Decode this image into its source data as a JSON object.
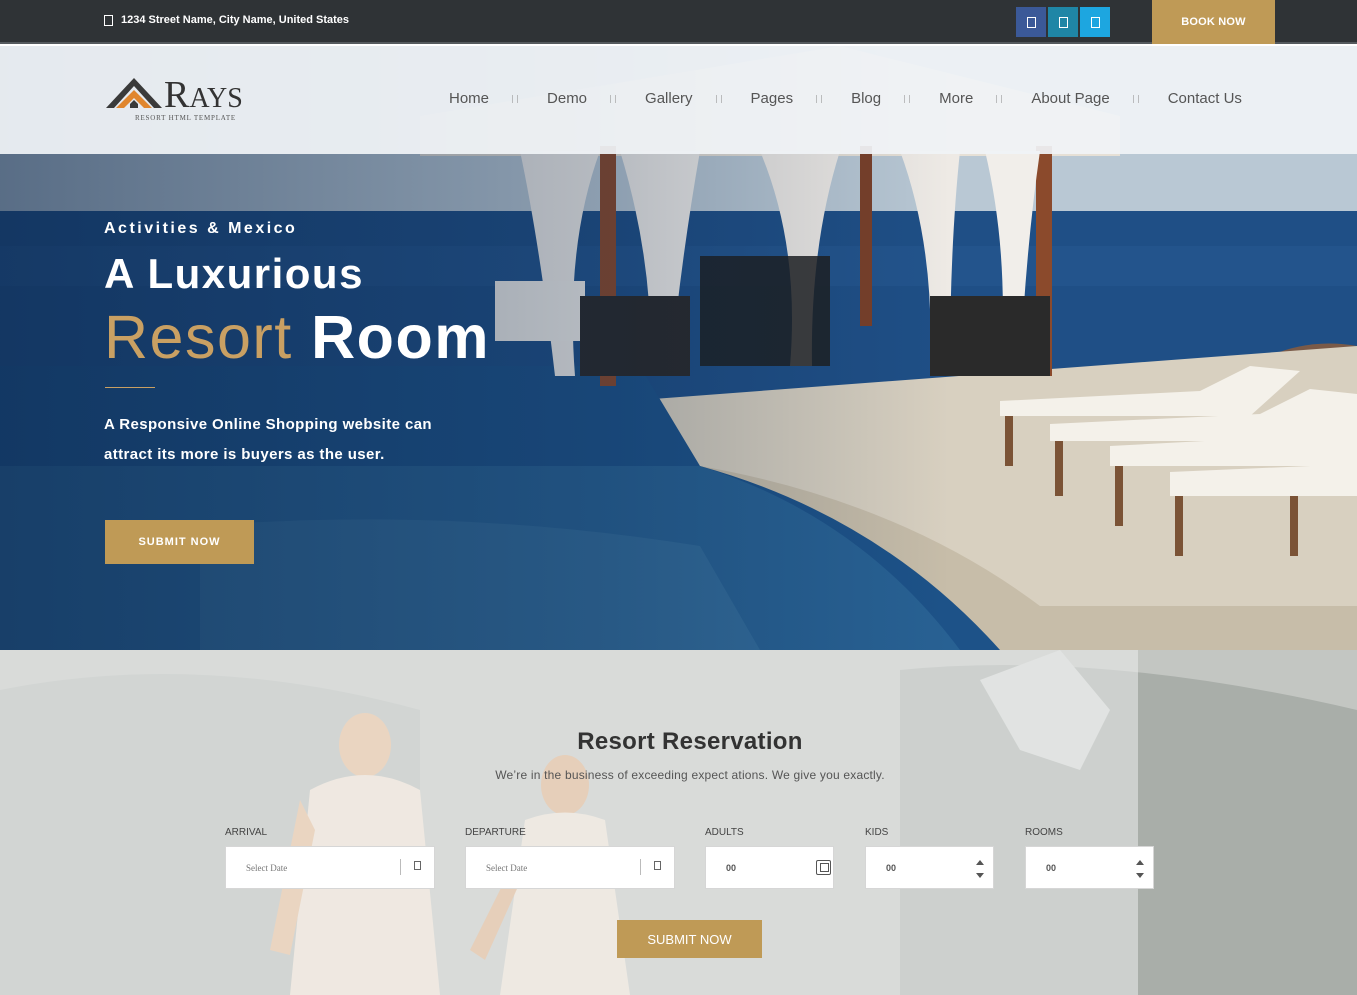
{
  "topbar": {
    "address": "1234 Street Name, City Name, United States",
    "social_icons": [
      "facebook-icon",
      "linkedin-icon",
      "twitter-icon"
    ],
    "social_colors": [
      "#3b5998",
      "#1f86a6",
      "#1da6e0"
    ],
    "book_now": "BOOK NOW"
  },
  "logo": {
    "name_initial": "R",
    "name_rest": "AYS",
    "tagline": "RESORT HTML TEMPLATE"
  },
  "nav": {
    "items": [
      "Home",
      "Demo",
      "Gallery",
      "Pages",
      "Blog",
      "More",
      "About Page",
      "Contact Us"
    ]
  },
  "banner": {
    "subtitle": "Activities & Mexico",
    "title_line1": "A Luxurious",
    "title_gold": "Resort",
    "title_white": "Room",
    "description": "A Responsive Online Shopping website can attract its more is buyers as the user.",
    "button": "SUBMIT NOW"
  },
  "reservation": {
    "title": "Resort Reservation",
    "subtitle": "We’re in the business of exceeding expect ations. We give you exactly.",
    "fields": {
      "arrival": {
        "label": "ARRIVAL",
        "placeholder": "Select Date"
      },
      "departure": {
        "label": "DEPARTURE",
        "placeholder": "Select Date"
      },
      "adults": {
        "label": "ADULTS",
        "value": "00"
      },
      "kids": {
        "label": "KIDS",
        "value": "00"
      },
      "rooms": {
        "label": "ROOMS",
        "value": "00"
      }
    },
    "button": "SUBMIT NOW"
  },
  "colors": {
    "accent": "#bf9a56",
    "topbar_bg": "#2f3336"
  }
}
